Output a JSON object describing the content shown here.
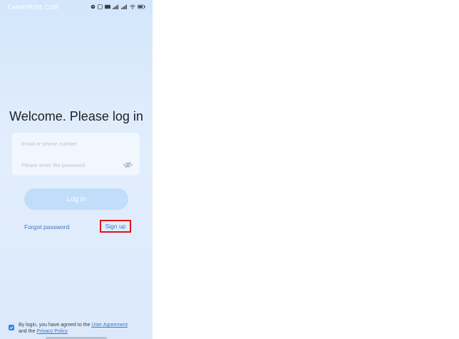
{
  "status_bar": {
    "time": "CAMAPP265.COM",
    "icons": [
      "alarm-icon",
      "nfc-icon",
      "hd-icon",
      "signal-icon",
      "signal-icon",
      "wifi-icon",
      "battery-icon"
    ]
  },
  "title": "Welcome. Please log in",
  "form": {
    "email_placeholder": "Email or phone number",
    "password_placeholder": "Please enter the password.",
    "login_label": "Log in"
  },
  "links": {
    "forgot_password": "Forgot password",
    "sign_up": "Sign up"
  },
  "agreement": {
    "checked": true,
    "prefix": "By login, you have agreed to the",
    "user_agreement": "User Agreement",
    "and": "and the",
    "privacy_policy": "Privacy Policy"
  },
  "colors": {
    "accent": "#3d78c4",
    "login_button": "#c0ddfa",
    "highlight": "#e0141a"
  }
}
